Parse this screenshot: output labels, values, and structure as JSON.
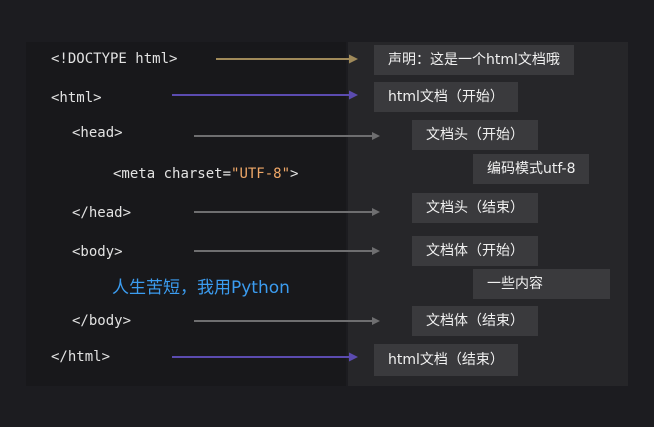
{
  "code": {
    "doctype": "<!DOCTYPE html>",
    "html_open": "<html>",
    "head_open": "<head>",
    "meta_tag": "<meta",
    "meta_attr": " charset=",
    "meta_value": "\"UTF-8\"",
    "meta_close": ">",
    "head_close": "</head>",
    "body_open": "<body>",
    "body_content": "人生苦短，我用Python",
    "body_close": "</body>",
    "html_close": "</html>"
  },
  "labels": {
    "doctype": "声明：这是一个html文档哦",
    "html_start": "html文档（开始）",
    "head_start": "文档头（开始）",
    "meta": "编码模式utf-8",
    "head_end": "文档头（结束）",
    "body_start": "文档体（开始）",
    "body_content": "一些内容",
    "body_end": "文档体（结束）",
    "html_end": "html文档（结束）"
  },
  "colors": {
    "doctype_arrow": "#a08a5a",
    "html_arrow": "#5b4bb0",
    "inner_arrow": "#6e6e70",
    "note_text": "#3b9cf0",
    "string_value": "#f0a868"
  }
}
